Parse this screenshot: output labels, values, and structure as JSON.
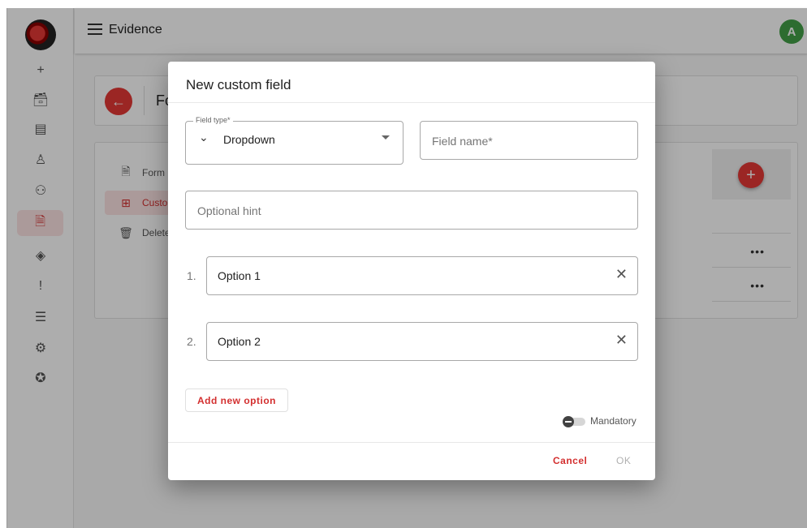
{
  "app": {
    "title": "Evidence",
    "avatar_initial": "A",
    "logo_icon": "app-logo",
    "rail_items": [
      {
        "icon": "plus-icon",
        "glyph": "+"
      },
      {
        "icon": "archive-icon",
        "glyph": "🗃"
      },
      {
        "icon": "report-icon",
        "glyph": "▤"
      },
      {
        "icon": "person-icon",
        "glyph": "♙"
      },
      {
        "icon": "people-icon",
        "glyph": "⚇"
      },
      {
        "icon": "form-icon",
        "glyph": "🗎",
        "active": true
      },
      {
        "icon": "warning-diamond-icon",
        "glyph": "◈"
      },
      {
        "icon": "exclamation-icon",
        "glyph": "!"
      },
      {
        "icon": "server-icon",
        "glyph": "☰"
      },
      {
        "icon": "settings-icon",
        "glyph": "⚙"
      },
      {
        "icon": "badge-icon",
        "glyph": "✪"
      }
    ]
  },
  "page": {
    "header_title": "Fo",
    "side_items": [
      {
        "label": "Form",
        "icon": "form-doc-icon",
        "glyph": "🗎"
      },
      {
        "label": "Custo",
        "icon": "custom-field-icon",
        "glyph": "⊞",
        "active": true
      },
      {
        "label": "Delete",
        "icon": "delete-icon",
        "glyph": "🗑"
      }
    ],
    "row_menu_glyph": "•••"
  },
  "dialog": {
    "title": "New custom field",
    "field_type": {
      "label": "Field type*",
      "value": "Dropdown"
    },
    "field_name_placeholder": "Field name*",
    "hint_placeholder": "Optional hint",
    "options": [
      {
        "number": "1.",
        "value": "Option 1"
      },
      {
        "number": "2.",
        "value": "Option 2"
      }
    ],
    "add_option_label": "Add new option",
    "mandatory_label": "Mandatory",
    "mandatory_on": false,
    "cancel_label": "Cancel",
    "ok_label": "OK"
  },
  "colors": {
    "accent": "#d32f2f",
    "avatar": "#43a047"
  }
}
